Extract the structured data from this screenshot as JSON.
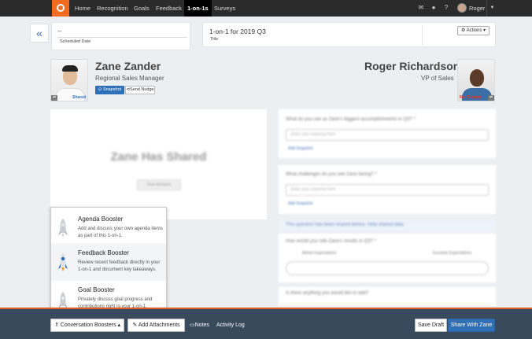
{
  "nav": {
    "links": [
      "Home",
      "Recognition",
      "Goals",
      "Feedback",
      "1-on-1s",
      "Surveys"
    ],
    "user": "Roger"
  },
  "meeting": {
    "scheduled_value": "--",
    "scheduled_label": "Scheduled Date",
    "title_value": "1-on-1 for 2019 Q3",
    "title_label": "Title",
    "actions_label": "Actions"
  },
  "employee": {
    "name": "Zane Zander",
    "role": "Regional Sales Manager",
    "status": "Shared",
    "snapshot_label": "Snapshot",
    "nudge_label": "Send Nudge"
  },
  "manager": {
    "name": "Roger Richardson",
    "role": "VP of Sales",
    "status": "Not Started"
  },
  "shared_panel": {
    "title": "Zane Has Shared",
    "button": "View Answers"
  },
  "questions": [
    {
      "text": "What do you see as Zane's biggest accomplishments in Q3? *",
      "placeholder": "Enter your response here",
      "link": "Add Snapshot"
    },
    {
      "text": "What challenges do you see Zane facing? *",
      "placeholder": "Enter your response here",
      "link": "Add Snapshot"
    },
    {
      "text": "This question has been shared before. Hide shared data",
      "placeholder": "",
      "link": ""
    },
    {
      "text": "How would you rate Zane's results in Q3? *",
      "placeholder": "",
      "link": ""
    },
    {
      "text": "Is there anything you would like to add?",
      "placeholder": "",
      "link": ""
    }
  ],
  "rating_labels": [
    "Below Expectations",
    "Exceeds Expectations"
  ],
  "boosters": [
    {
      "title": "Agenda Booster",
      "desc": "Add and discuss your own agenda items as part of this 1-on-1."
    },
    {
      "title": "Feedback Booster",
      "desc": "Review recent feedback directly in your 1-on-1 and document key takeaways."
    },
    {
      "title": "Goal Booster",
      "desc": "Privately discuss goal progress and contributions right in your 1-on-1."
    }
  ],
  "bottom": {
    "boosters_label": "Conversation Boosters",
    "attach_label": "Add Attachments",
    "notes_label": "Notes",
    "activity_label": "Activity Log",
    "save_label": "Save Draft",
    "share_label": "Share With Zane"
  },
  "colors": {
    "brand": "#f26b21",
    "primary": "#2e6fb7",
    "nav_bg": "#2b2b2b",
    "bottom_bg": "#3a4a5d"
  }
}
